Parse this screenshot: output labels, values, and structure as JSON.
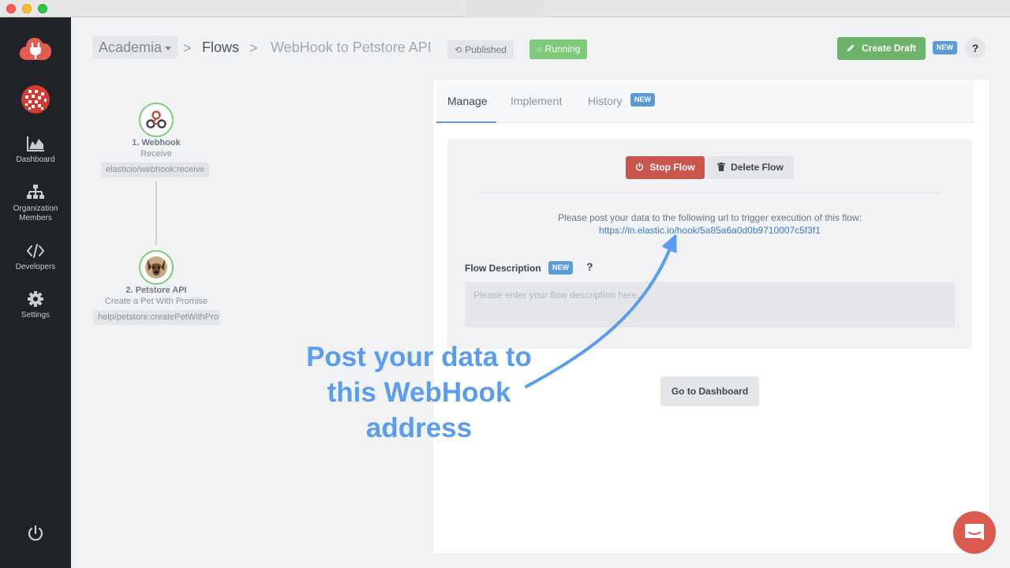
{
  "header": {
    "org": "Academia",
    "sep": ">",
    "flows": "Flows",
    "flow_name": "WebHook to Petstore API",
    "published": "Published",
    "running": "Running",
    "create_draft": "Create Draft",
    "new": "NEW",
    "help": "?"
  },
  "sidebar": {
    "items": [
      {
        "label_line1": "Dashboard",
        "label_line2": ""
      },
      {
        "label_line1": "Organization",
        "label_line2": "Members"
      },
      {
        "label_line1": "Developers",
        "label_line2": ""
      },
      {
        "label_line1": "Settings",
        "label_line2": ""
      }
    ]
  },
  "flow_graph": {
    "nodes": [
      {
        "title": "1. Webhook",
        "subtitle": "Receive",
        "component": "elasticio/webhook:receive"
      },
      {
        "title": "2. Petstore API",
        "subtitle": "Create a Pet With Promise",
        "component": "help/petstore:createPetWithPro"
      }
    ]
  },
  "tabs": [
    {
      "label": "Manage"
    },
    {
      "label": "Implement"
    },
    {
      "label": "History"
    }
  ],
  "tab_new": "NEW",
  "manage": {
    "stop_flow": "Stop Flow",
    "delete_flow": "Delete Flow",
    "post_text": "Please post your data to the following url to trigger execution of this flow:",
    "hook_url": "https://in.elastic.io/hook/5a85a6a0d0b9710007c5f3f1",
    "description_label": "Flow Description",
    "description_new": "NEW",
    "description_help": "?",
    "description_placeholder": "Please enter your flow description here.",
    "go_dashboard": "Go to Dashboard"
  },
  "annotation": {
    "line1": "Post your data to",
    "line2": "this WebHook",
    "line3": "address"
  },
  "colors": {
    "accent": "#5b9bd5",
    "running": "#7ec97a",
    "danger": "#c9554c",
    "annotation": "#5b9ded"
  }
}
